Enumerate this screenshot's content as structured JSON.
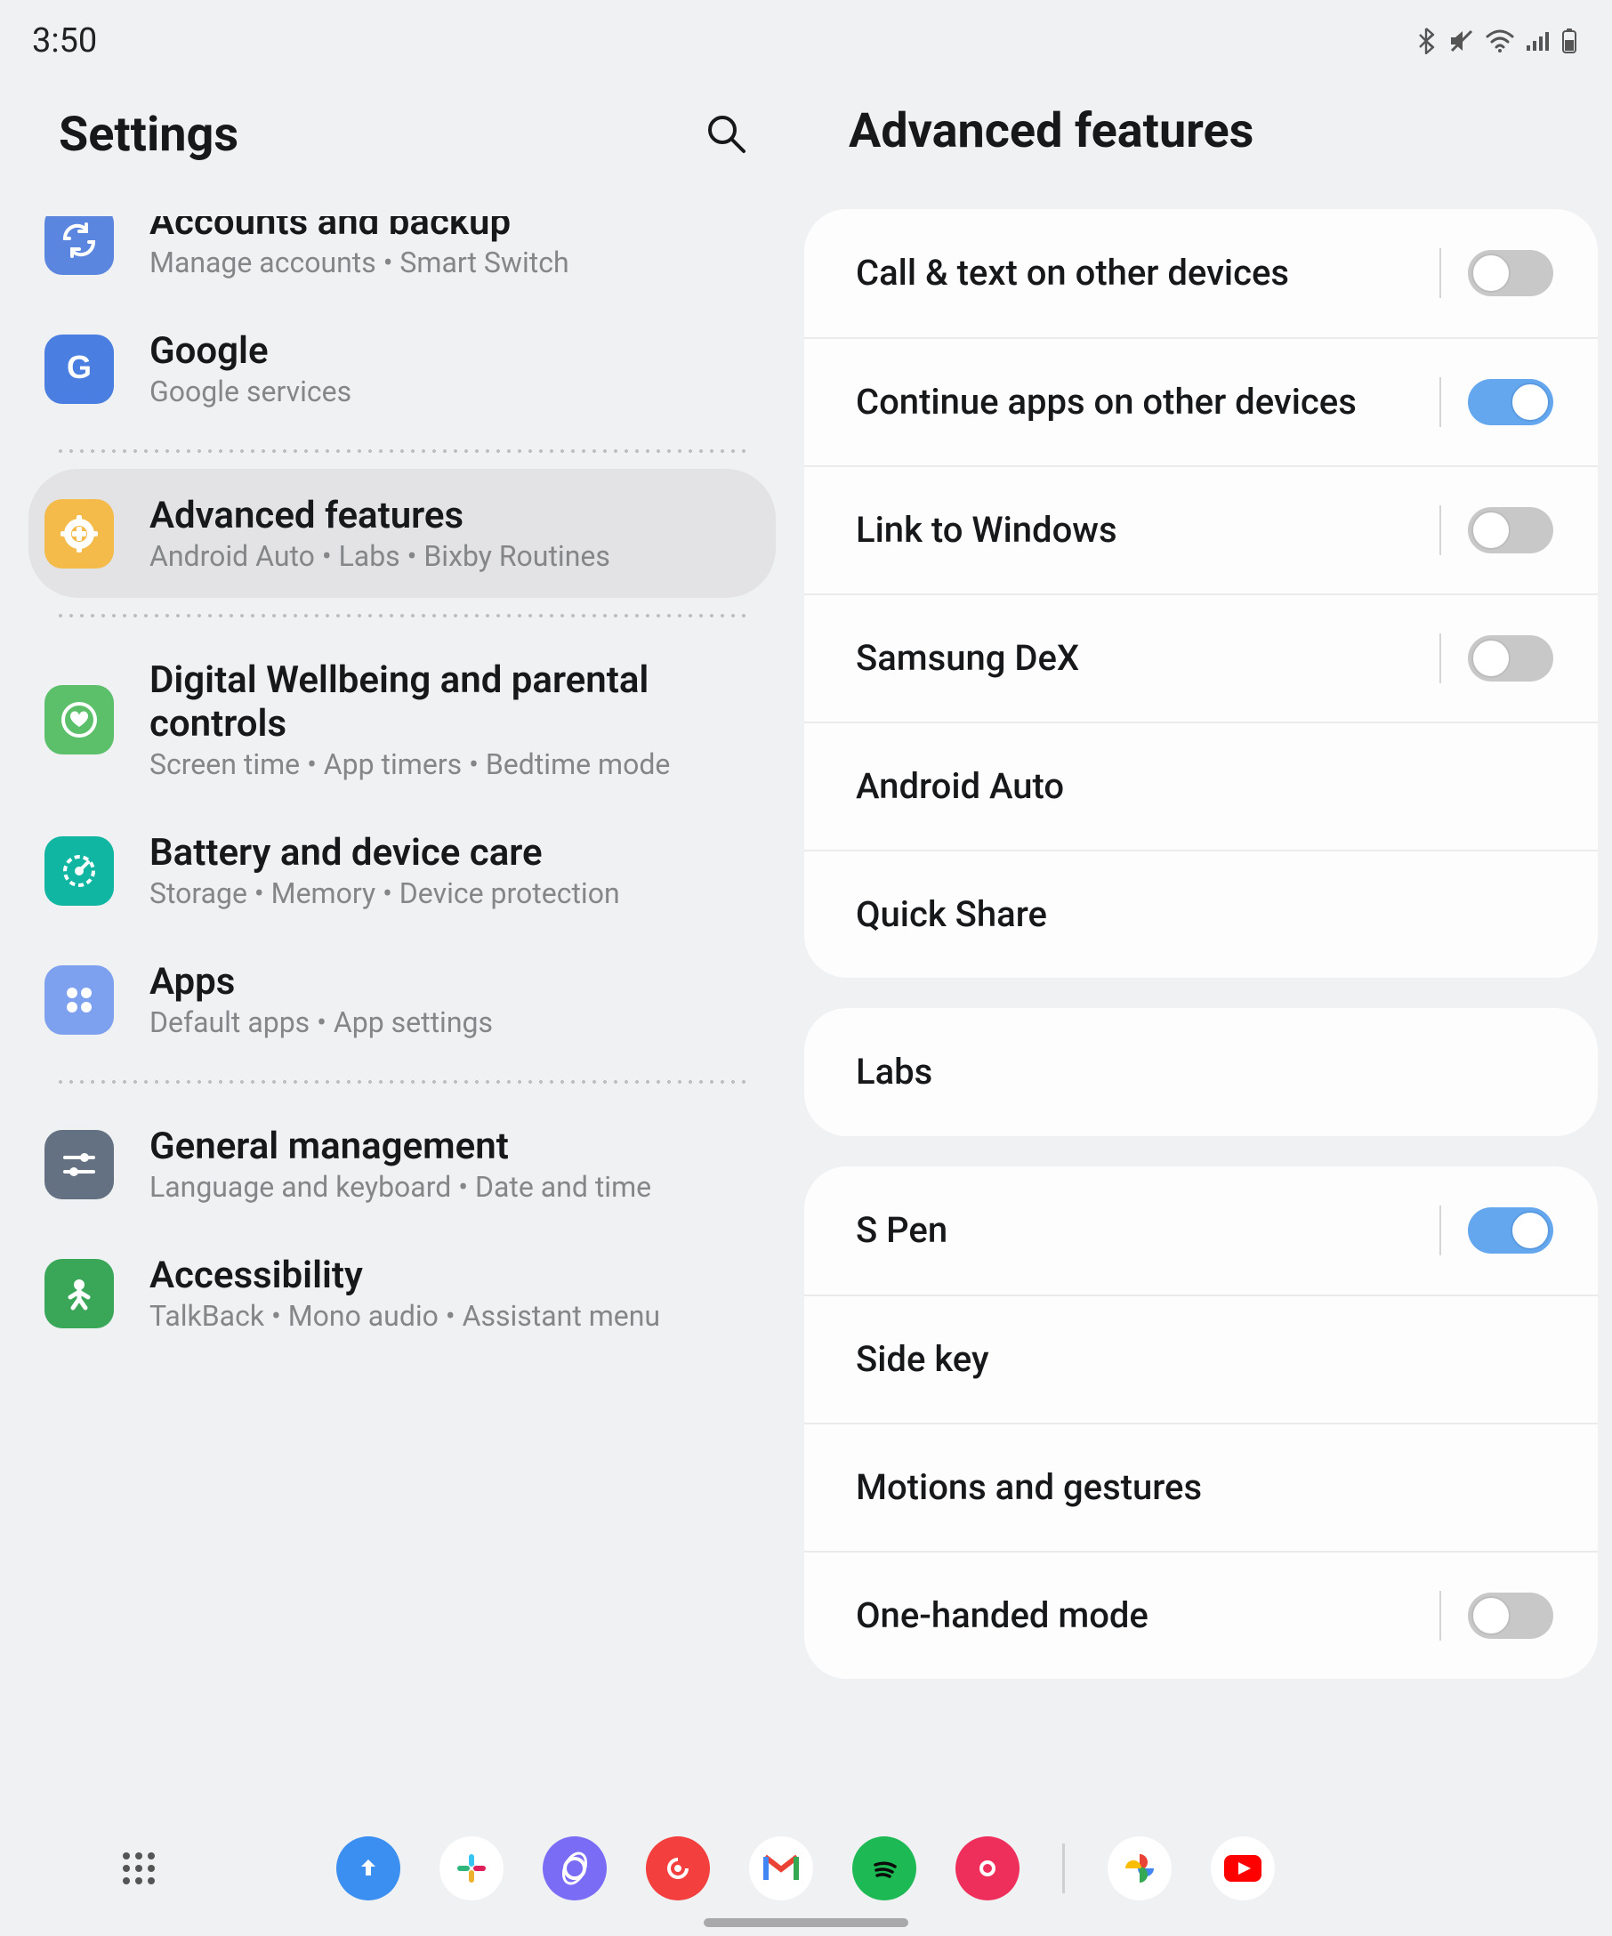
{
  "status": {
    "time": "3:50"
  },
  "left": {
    "title": "Settings",
    "items": [
      {
        "id": "accounts",
        "title": "Accounts and backup",
        "sub": "Manage accounts  •  Smart Switch",
        "icon": "sync-icon",
        "color": "#5b86df"
      },
      {
        "id": "google",
        "title": "Google",
        "sub": "Google services",
        "icon": "google-icon",
        "color": "#4a7fe1"
      },
      {
        "divider": true
      },
      {
        "id": "advanced",
        "title": "Advanced features",
        "sub": "Android Auto  •  Labs  •  Bixby Routines",
        "icon": "plus-gear-icon",
        "color": "#f4bb4b",
        "selected": true
      },
      {
        "divider": true
      },
      {
        "id": "wellbeing",
        "title": "Digital Wellbeing and parental controls",
        "sub": "Screen time  •  App timers  •  Bedtime mode",
        "icon": "heart-circle-icon",
        "color": "#5cbf6a"
      },
      {
        "id": "battery",
        "title": "Battery and device care",
        "sub": "Storage  •  Memory  •  Device protection",
        "icon": "meter-icon",
        "color": "#10b6a1"
      },
      {
        "id": "apps",
        "title": "Apps",
        "sub": "Default apps  •  App settings",
        "icon": "grid4-icon",
        "color": "#7da0ef"
      },
      {
        "divider": true
      },
      {
        "id": "general",
        "title": "General management",
        "sub": "Language and keyboard  •  Date and time",
        "icon": "sliders-icon",
        "color": "#637182"
      },
      {
        "id": "accessibility",
        "title": "Accessibility",
        "sub": "TalkBack  •  Mono audio  •  Assistant menu",
        "icon": "person-icon",
        "color": "#3aa758"
      }
    ]
  },
  "right": {
    "title": "Advanced features",
    "groups": [
      {
        "rows": [
          {
            "label": "Call & text on other devices",
            "toggle": false
          },
          {
            "label": "Continue apps on other devices",
            "toggle": true
          },
          {
            "label": "Link to Windows",
            "toggle": false
          },
          {
            "label": "Samsung DeX",
            "toggle": false
          },
          {
            "label": "Android Auto"
          },
          {
            "label": "Quick Share"
          }
        ]
      },
      {
        "rows": [
          {
            "label": "Labs"
          }
        ]
      },
      {
        "rows": [
          {
            "label": "S Pen",
            "toggle": true
          },
          {
            "label": "Side key"
          },
          {
            "label": "Motions and gestures"
          },
          {
            "label": "One-handed mode",
            "toggle": false
          }
        ]
      }
    ]
  },
  "taskbar": {
    "apps": [
      {
        "name": "upload-app-icon",
        "bg": "#3a8ff0"
      },
      {
        "name": "slack-app-icon",
        "bg": "#fff"
      },
      {
        "name": "samsung-internet-app-icon",
        "bg": "#7b6cf6"
      },
      {
        "name": "pocketcasts-app-icon",
        "bg": "#f33f3d"
      },
      {
        "name": "gmail-app-icon",
        "bg": "#fff"
      },
      {
        "name": "spotify-app-icon",
        "bg": "#1db954"
      },
      {
        "name": "camera-app-icon",
        "bg": "#ef2f5b"
      }
    ],
    "recent": [
      {
        "name": "photos-app-icon",
        "bg": "#fff"
      },
      {
        "name": "youtube-app-icon",
        "bg": "#fff"
      }
    ]
  }
}
